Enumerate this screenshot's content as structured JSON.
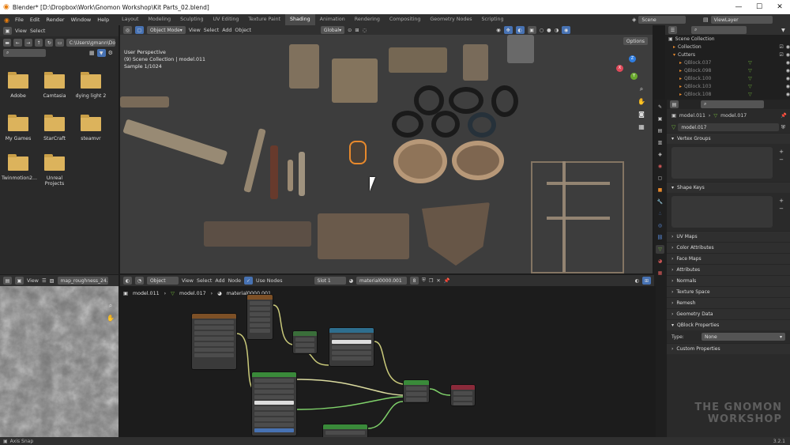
{
  "window": {
    "title": "Blender* [D:\\Dropbox\\Work\\Gnomon Workshop\\Kit Parts_02.blend]"
  },
  "menu": [
    "File",
    "Edit",
    "Render",
    "Window",
    "Help"
  ],
  "workspaces": [
    {
      "label": "Layout",
      "active": false
    },
    {
      "label": "Modeling",
      "active": false
    },
    {
      "label": "Sculpting",
      "active": false
    },
    {
      "label": "UV Editing",
      "active": false
    },
    {
      "label": "Texture Paint",
      "active": false
    },
    {
      "label": "Shading",
      "active": true
    },
    {
      "label": "Animation",
      "active": false
    },
    {
      "label": "Rendering",
      "active": false
    },
    {
      "label": "Compositing",
      "active": false
    },
    {
      "label": "Geometry Nodes",
      "active": false
    },
    {
      "label": "Scripting",
      "active": false
    }
  ],
  "scene": {
    "name": "Scene",
    "view_layer": "ViewLayer"
  },
  "file_browser": {
    "menu_view": "View",
    "menu_select": "Select",
    "path": "C:\\Users\\gmann\\Docu...",
    "folders": [
      "Adobe",
      "Camtasia",
      "dying light 2",
      "My Games",
      "StarCraft",
      "steamvr",
      "Twinmotion2...",
      "Unreal Projects"
    ]
  },
  "viewport": {
    "mode": "Object Mode",
    "menu": [
      "View",
      "Select",
      "Add",
      "Object"
    ],
    "orientation": "Global",
    "options_label": "Options",
    "info_line1": "User Perspective",
    "info_line2": "(9) Scene Collection | model.011",
    "info_line3": "Sample 1/1024",
    "gizmo": {
      "x": "X",
      "y": "Y",
      "z": "Z"
    }
  },
  "outliner": {
    "root": "Scene Collection",
    "items": [
      "Collection",
      "Cutters",
      "QBlock.037",
      "QBlock.098",
      "QBlock.100",
      "QBlock.103",
      "QBlock.108"
    ]
  },
  "properties": {
    "breadcrumb_object": "model.011",
    "breadcrumb_data": "model.017",
    "data_name": "model.017",
    "sections": [
      "Vertex Groups",
      "Shape Keys",
      "UV Maps",
      "Color Attributes",
      "Face Maps",
      "Attributes",
      "Normals",
      "Texture Space",
      "Remesh",
      "Geometry Data",
      "QBlock Properties",
      "Custom Properties"
    ],
    "qblock_type_label": "Type:",
    "qblock_type_value": "None"
  },
  "image_editor": {
    "view_label": "View",
    "image_name": "map_roughness_24..."
  },
  "node_editor": {
    "object_label": "Object",
    "menu": [
      "View",
      "Select",
      "Add",
      "Node"
    ],
    "use_nodes_label": "Use Nodes",
    "slot_label": "Slot 1",
    "material_name": "material0000.001",
    "users_count": "8",
    "breadcrumb": [
      "model.011",
      "model.017",
      "material0000.001"
    ]
  },
  "status_bar": {
    "left": "Axis Snap",
    "version": "3.2.1"
  },
  "watermark": {
    "line1": "THE GNOMON",
    "line2": "WORKSHOP"
  },
  "colors": {
    "accent": "#4772b3",
    "active_object": "#e8892c",
    "folder": "#dcb35c"
  }
}
